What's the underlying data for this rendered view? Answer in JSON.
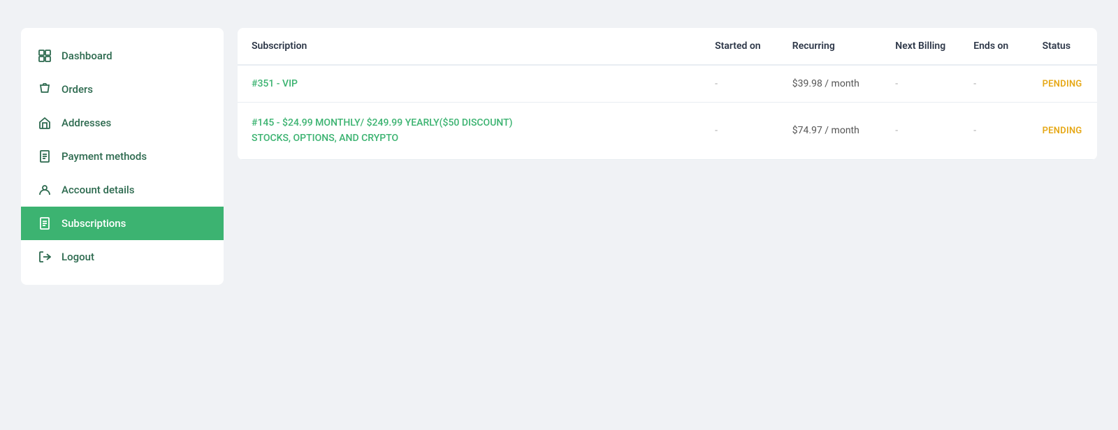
{
  "sidebar": {
    "items": [
      {
        "id": "dashboard",
        "label": "Dashboard",
        "icon": "grid"
      },
      {
        "id": "orders",
        "label": "Orders",
        "icon": "shopping-bag"
      },
      {
        "id": "addresses",
        "label": "Addresses",
        "icon": "home"
      },
      {
        "id": "payment-methods",
        "label": "Payment methods",
        "icon": "file"
      },
      {
        "id": "account-details",
        "label": "Account details",
        "icon": "user"
      },
      {
        "id": "subscriptions",
        "label": "Subscriptions",
        "icon": "document",
        "active": true
      },
      {
        "id": "logout",
        "label": "Logout",
        "icon": "logout"
      }
    ]
  },
  "table": {
    "columns": [
      {
        "id": "subscription",
        "label": "Subscription"
      },
      {
        "id": "started_on",
        "label": "Started on"
      },
      {
        "id": "recurring",
        "label": "Recurring"
      },
      {
        "id": "next_billing",
        "label": "Next Billing"
      },
      {
        "id": "ends_on",
        "label": "Ends on"
      },
      {
        "id": "status",
        "label": "Status"
      }
    ],
    "rows": [
      {
        "id": "row-1",
        "subscription_link": "#351 - VIP",
        "subscription_extra": "",
        "started_on": "-",
        "recurring": "$39.98 / month",
        "next_billing": "-",
        "ends_on": "-",
        "status": "PENDING"
      },
      {
        "id": "row-2",
        "subscription_link": "#145 - $24.99 MONTHLY/ $249.99 YEARLY($50 DISCOUNT)",
        "subscription_extra": "STOCKS, OPTIONS, AND CRYPTO",
        "started_on": "-",
        "recurring": "$74.97 / month",
        "next_billing": "-",
        "ends_on": "-",
        "status": "PENDING"
      }
    ]
  }
}
